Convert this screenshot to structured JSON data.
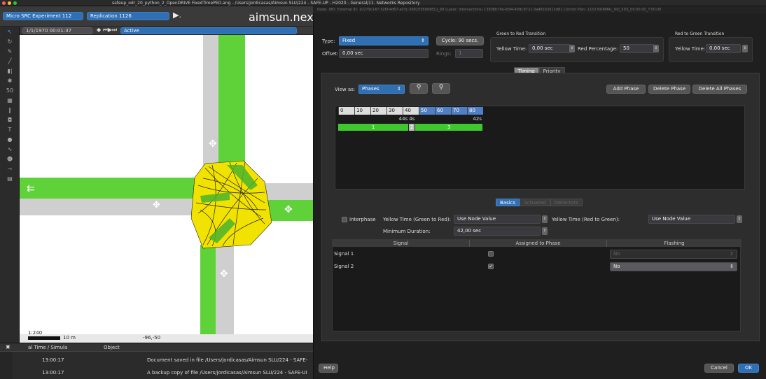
{
  "window": {
    "title": "safeup_odr_20_python_2_OpenDRIVE FixedTimePED.ang - /Users/jordicasas/Aimsun SLU/224 - SAFE-UP - H2020 - General/11. Networks Repository"
  },
  "toolbar": {
    "experiment": "Micro SRC Experiment 112",
    "replication": "Replication 1126",
    "play_glyph": "▶.",
    "logo_main": "aimsun.nex",
    "logo_accent": "t",
    "time": "1/1/1970 00:01:37",
    "active_label": "Active"
  },
  "map": {
    "scale": "1:240",
    "scale_len": "10 m",
    "coords": "-96,-50"
  },
  "log": {
    "col_time": "al Time / Simula",
    "col_object": "Object",
    "rows": [
      {
        "time": "13:00:17",
        "message": "Document saved in file /Users/jordicasas/Aimsun SLU/224 - SAFE-"
      },
      {
        "time": "13:00:17",
        "message": "A backup copy of file /Users/jordicasas/Aimsun SLU/224 - SAFE-UI"
      }
    ]
  },
  "dialog": {
    "title": "Node: 987, External ID: {0279c147-326f-4d67-a03c-36825568d981}_68 (Layer: Intersections) {3808b79e-0fd4-40fb-8721-3a48163015d8} Control Plan: 1153 NORMAL_NO_XDS_00:00:00_7:00:00",
    "type_label": "Type:",
    "type_value": "Fixed",
    "cycle": "Cycle: 90 secs.",
    "offset_label": "Offset:",
    "offset_value": "0,00 sec",
    "rings_label": "Rings:",
    "rings_value": "1",
    "g2r_title": "Green to Red Transition",
    "g2r_yellow_label": "Yellow Time:",
    "g2r_yellow_value": "0,00 sec",
    "red_pct_label": "Red Percentage:",
    "red_pct_value": "50",
    "r2g_title": "Red to Green Transition",
    "r2g_yellow_label": "Yellow Time:",
    "r2g_yellow_value": "0,00 sec",
    "tab_timing": "Timing",
    "tab_priority": "Priority",
    "view_as_label": "View as:",
    "view_as_value": "Phases",
    "add_phase": "Add Phase",
    "delete_phase": "Delete Phase",
    "delete_all": "Delete All Phases",
    "timeline_ticks": [
      "0",
      "10",
      "20",
      "30",
      "40",
      "50",
      "60",
      "70",
      "80"
    ],
    "phase_durations": [
      "44s",
      "4s",
      "42s"
    ],
    "phases": [
      {
        "label": "1",
        "duration": 44,
        "color": "#3fc72e"
      },
      {
        "label": "2",
        "duration": 4,
        "color": "#bbbbbb"
      },
      {
        "label": "3",
        "duration": 42,
        "color": "#3fc72e"
      }
    ],
    "subtab_basics": "Basics",
    "subtab_actuated": "Actuated",
    "subtab_detectors": "Detectors",
    "interphase_label": "Interphase",
    "yellow_g2r_label": "Yellow Time (Green to Red):",
    "yellow_g2r_value": "Use Node Value",
    "yellow_r2g_label": "Yellow Time (Red to Green):",
    "yellow_r2g_value": "Use Node Value",
    "min_duration_label": "Minimum Duration:",
    "min_duration_value": "42,00 sec",
    "table_headers": [
      "Signal",
      "Assigned to Phase",
      "Flashing"
    ],
    "signals": [
      {
        "name": "Signal 1",
        "assigned": false,
        "flashing": "No"
      },
      {
        "name": "Signal 2",
        "assigned": true,
        "flashing": "No"
      }
    ],
    "help": "Help",
    "cancel": "Cancel",
    "ok": "OK"
  },
  "colors": {
    "road_gray": "#cfcfcf",
    "road_green": "#5fd23a",
    "junction_yellow": "#f2e200",
    "accent_blue": "#2f6fb4"
  }
}
